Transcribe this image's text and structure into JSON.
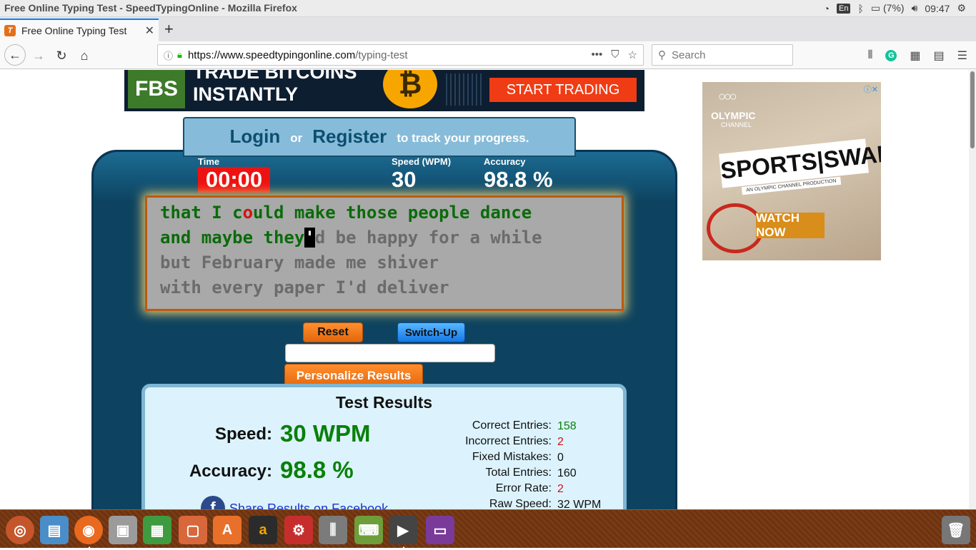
{
  "window": {
    "title": "Free Online Typing Test - SpeedTypingOnline - Mozilla Firefox"
  },
  "tray": {
    "keyboard_layout": "En",
    "battery": "(7%)",
    "clock": "09:47"
  },
  "browser": {
    "tab_title": "Free Online Typing Test",
    "url_host": "https://www.speedtypingonline.com",
    "url_path": "/typing-test",
    "search_placeholder": "Search"
  },
  "ad_top": {
    "brand": "FBS",
    "headline_line1": "TRADE BITCOINS",
    "headline_line2": "INSTANTLY",
    "coin_symbol": "₿",
    "cta": "START TRADING"
  },
  "login": {
    "login_label": "Login",
    "or_label": "or",
    "register_label": "Register",
    "suffix": "to track your progress."
  },
  "stats": {
    "time_label": "Time",
    "time_value": "00:00",
    "speed_label": "Speed (WPM)",
    "speed_value": "30",
    "accuracy_label": "Accuracy",
    "accuracy_value": "98.8 %"
  },
  "typing_text": {
    "line1_a": "that I c",
    "line1_err": "o",
    "line1_b": "uld make those people dance",
    "line2_typed": "and maybe they",
    "line2_cursor": "'",
    "line2_pending": "d be happy for a while",
    "line3": "but February made me shiver",
    "line4": "with every paper I'd deliver"
  },
  "buttons": {
    "reset": "Reset",
    "switch_up": "Switch-Up",
    "personalize": "Personalize Results"
  },
  "results": {
    "heading": "Test Results",
    "speed_label": "Speed:",
    "speed_value": "30 WPM",
    "accuracy_label": "Accuracy:",
    "accuracy_value": "98.8 %",
    "share_text": "Share Results on Facebook",
    "details": {
      "correct_label": "Correct Entries:",
      "correct_value": "158",
      "incorrect_label": "Incorrect Entries:",
      "incorrect_value": "2",
      "fixed_label": "Fixed Mistakes:",
      "fixed_value": "0",
      "total_label": "Total Entries:",
      "total_value": "160",
      "error_label": "Error Rate:",
      "error_value": "2",
      "raw_label": "Raw Speed:",
      "raw_value": "32 WPM"
    }
  },
  "ad_side": {
    "brand_line1": "OLYMPIC",
    "brand_line2": "CHANNEL",
    "headline": "SPORTS|SWAP",
    "subline": "AN OLYMPIC CHANNEL PRODUCTION",
    "cta": "WATCH NOW"
  },
  "colors": {
    "panel": "#0d4360",
    "time_red": "#ee1111",
    "typed_green": "#0a6b0a",
    "error_red": "#d31313",
    "orange": "#e3660c",
    "blue_button": "#1477e8"
  }
}
